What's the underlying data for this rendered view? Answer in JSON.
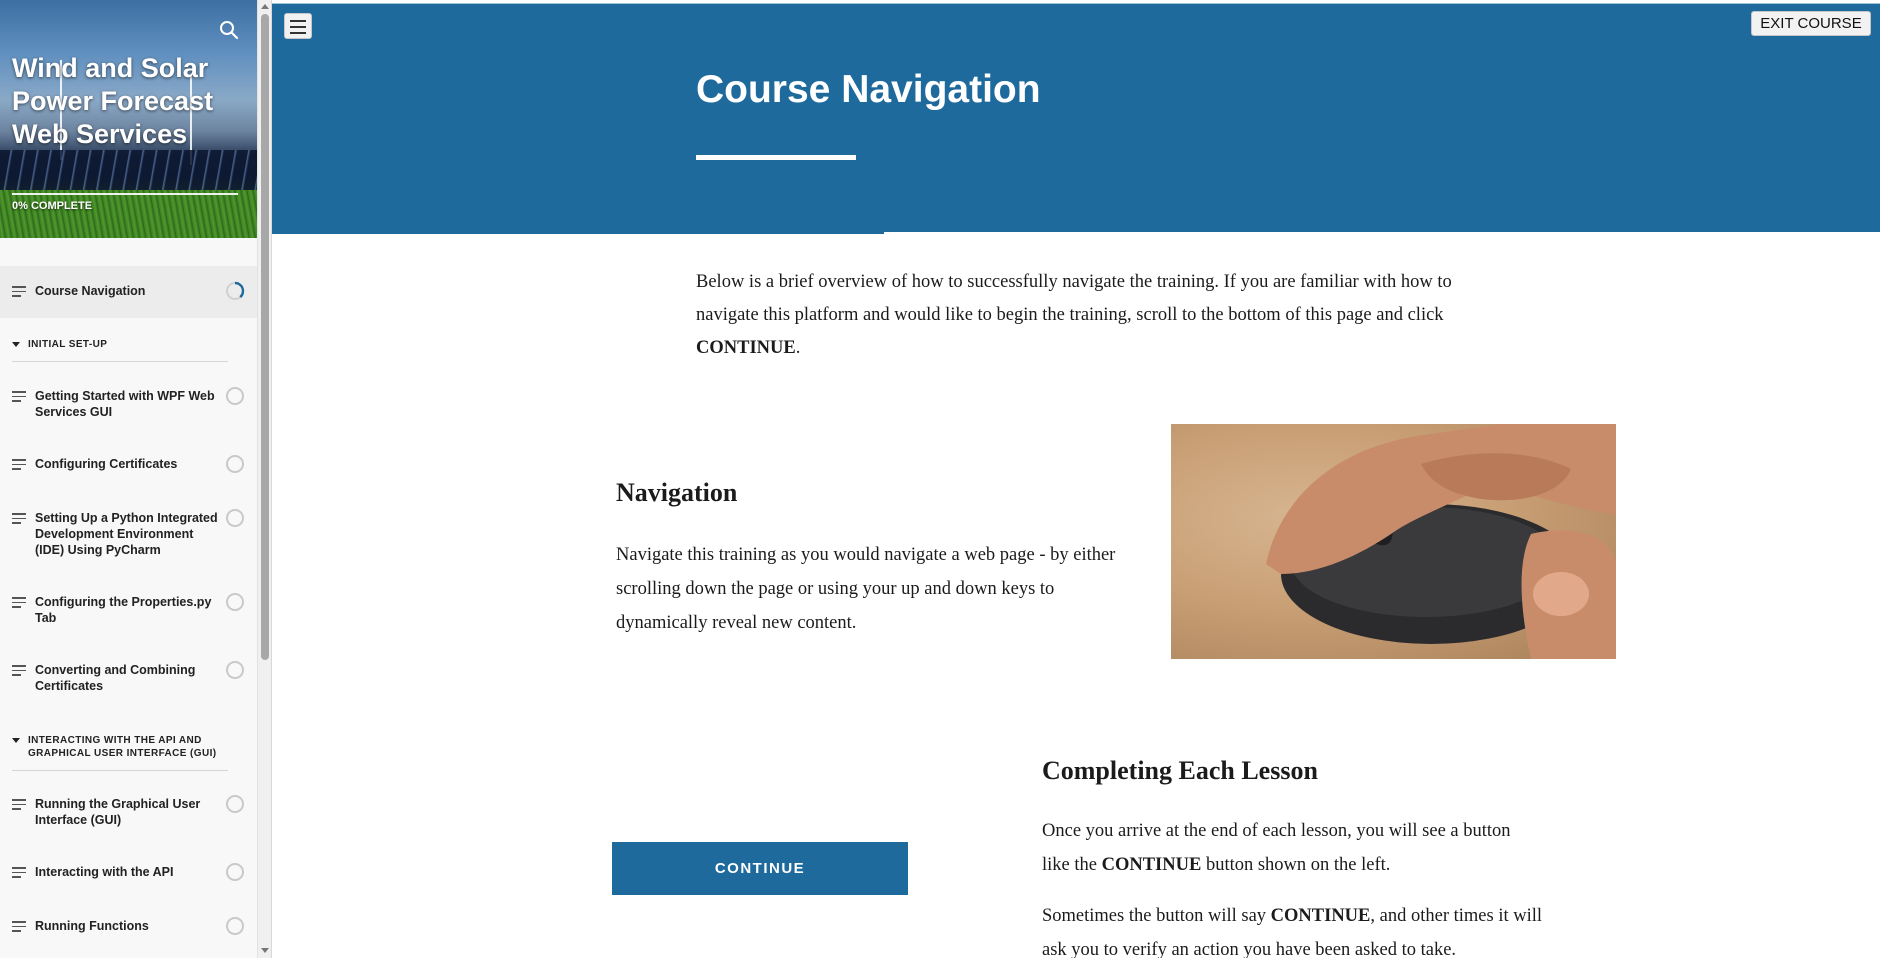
{
  "course": {
    "title": "Wind and Solar Power Forecast Web Services",
    "progress_label": "0% COMPLETE",
    "progress_percent": 0
  },
  "sidebar": {
    "search_icon": "search-icon",
    "items": [
      {
        "label": "Course Navigation",
        "status": "in-progress",
        "active": true
      },
      {
        "section": "INITIAL SET-UP"
      },
      {
        "label": "Getting Started with WPF Web Services GUI",
        "status": "not-started"
      },
      {
        "label": "Configuring Certificates",
        "status": "not-started"
      },
      {
        "label": "Setting Up a Python Integrated Development Environment (IDE) Using PyCharm",
        "status": "not-started"
      },
      {
        "label": "Configuring the Properties.py Tab",
        "status": "not-started"
      },
      {
        "label": "Converting and Combining Certificates",
        "status": "not-started"
      },
      {
        "section": "INTERACTING WITH THE API AND GRAPHICAL USER INTERFACE (GUI)"
      },
      {
        "label": "Running the Graphical User Interface (GUI)",
        "status": "not-started"
      },
      {
        "label": "Interacting with the API",
        "status": "not-started"
      },
      {
        "label": "Running Functions",
        "status": "not-started"
      }
    ]
  },
  "header": {
    "exit_label": "EXIT COURSE",
    "lesson_title": "Course Navigation",
    "accent_color": "#1f6a9c"
  },
  "content": {
    "intro_part1": "Below is a brief overview of how to successfully navigate the training.  If you are familiar with how to navigate this platform and would like to begin the training, scroll to the bottom of this page and click ",
    "intro_bold": "CONTINUE",
    "intro_end": ".",
    "navigation_heading": "Navigation",
    "navigation_text": "Navigate this training as you would navigate a web page - by either scrolling down the page or using your up and down keys to dynamically reveal new content.",
    "completing_heading": "Completing Each Lesson",
    "completing_text1_a": "Once you arrive at the end of each lesson, you will see a button like the ",
    "completing_text1_bold": "CONTINUE",
    "completing_text1_b": " button shown on the left.",
    "completing_text2_a": "Sometimes the button will say ",
    "completing_text2_bold": "CONTINUE",
    "completing_text2_b": ", and other times it will ask you to verify an action you have been asked to take.",
    "continue_button_label": "CONTINUE"
  }
}
